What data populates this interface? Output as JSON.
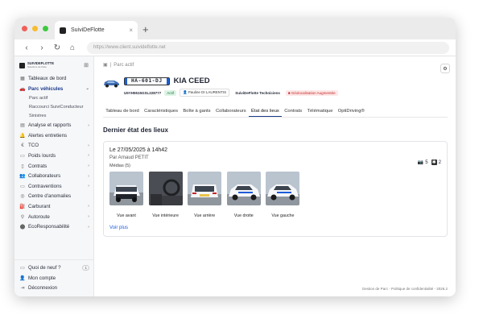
{
  "browser": {
    "tab_title": "SuiviDeFlotte",
    "tab_close": "×",
    "new_tab": "+",
    "url": "https://www.client.suivideflotte.net"
  },
  "brand": {
    "name": "SUIVIDEFLOTTE",
    "subtitle": "Solutions de flotte"
  },
  "sidebar": {
    "items": [
      {
        "label": "Tableaux de bord",
        "icon": "dashboard-icon",
        "glyph": "▦"
      },
      {
        "label": "Parc véhicules",
        "icon": "car-icon",
        "glyph": "🚗",
        "active": true,
        "chevron": "⌄"
      },
      {
        "label": "Analyse et rapports",
        "icon": "chart-icon",
        "glyph": "▤",
        "chevron": "›"
      },
      {
        "label": "Alertes entretiens",
        "icon": "bell-icon",
        "glyph": "🔔"
      },
      {
        "label": "TCO",
        "icon": "euro-icon",
        "glyph": "€",
        "chevron": "›"
      },
      {
        "label": "Poids lourds",
        "icon": "truck-icon",
        "glyph": "▭",
        "chevron": "›"
      },
      {
        "label": "Contrats",
        "icon": "document-icon",
        "glyph": "▯",
        "chevron": "›"
      },
      {
        "label": "Collaborateurs",
        "icon": "users-icon",
        "glyph": "👥",
        "chevron": "›"
      },
      {
        "label": "Contraventions",
        "icon": "ticket-icon",
        "glyph": "▭",
        "chevron": "›"
      },
      {
        "label": "Centre d'anomalies",
        "icon": "warning-icon",
        "glyph": "◎"
      },
      {
        "label": "Carburant",
        "icon": "fuel-icon",
        "glyph": "⛽",
        "chevron": "›"
      },
      {
        "label": "Autoroute",
        "icon": "road-icon",
        "glyph": "⚲",
        "chevron": "›"
      },
      {
        "label": "EcoResponsabilité",
        "icon": "leaf-icon",
        "glyph": "⬤",
        "chevron": "›"
      }
    ],
    "subitems": [
      "Parc actif",
      "Raccourci SuiviConducteur",
      "Sinistres"
    ],
    "bottom": [
      {
        "label": "Quoi de neuf ?",
        "icon": "news-icon",
        "glyph": "▭",
        "count": "1"
      },
      {
        "label": "Mon compte",
        "icon": "user-icon",
        "glyph": "👤"
      },
      {
        "label": "Déconnexion",
        "icon": "logout-icon",
        "glyph": "⇥"
      }
    ]
  },
  "breadcrumb": {
    "separator": "|",
    "current": "Parc actif"
  },
  "vehicle": {
    "plate": "HA-601-DJ",
    "name": "KIA CEED",
    "vin": "U5YH5515GSL228777",
    "status": "Actif",
    "driver": "Pauline DI LAURENTIS",
    "company": "SuiviDeFlotte Techniciens",
    "geoloc": "Géolocalisation Augmentée"
  },
  "tabs": [
    "Tableau de bord",
    "Caractéristiques",
    "Boîte à gants",
    "Collaborateurs",
    "État des lieux",
    "Contrats",
    "Télématique",
    "OptiDriving®"
  ],
  "active_tab": "État des lieux",
  "inspection": {
    "section_title": "Dernier état des lieux",
    "date": "Le 27/05/2025 à 14h42",
    "author": "Par Arnaud PETIT",
    "photo_count": "5",
    "damage_count": "2",
    "media_label": "Médias (5)",
    "photos": [
      {
        "caption": "Vue avant",
        "kind": "front"
      },
      {
        "caption": "Vue intérieure",
        "kind": "interior"
      },
      {
        "caption": "Vue arrière",
        "kind": "rear"
      },
      {
        "caption": "Vue droite",
        "kind": "side"
      },
      {
        "caption": "Vue gauche",
        "kind": "side"
      }
    ],
    "more_link": "Voir plus"
  },
  "footer": "Gestion de Parc - Politique de confidentialité - 2026.2",
  "colors": {
    "accent": "#1b3a8a",
    "link": "#1e5bd8",
    "active_green": "#1d7a43",
    "alert_red": "#c62828"
  }
}
